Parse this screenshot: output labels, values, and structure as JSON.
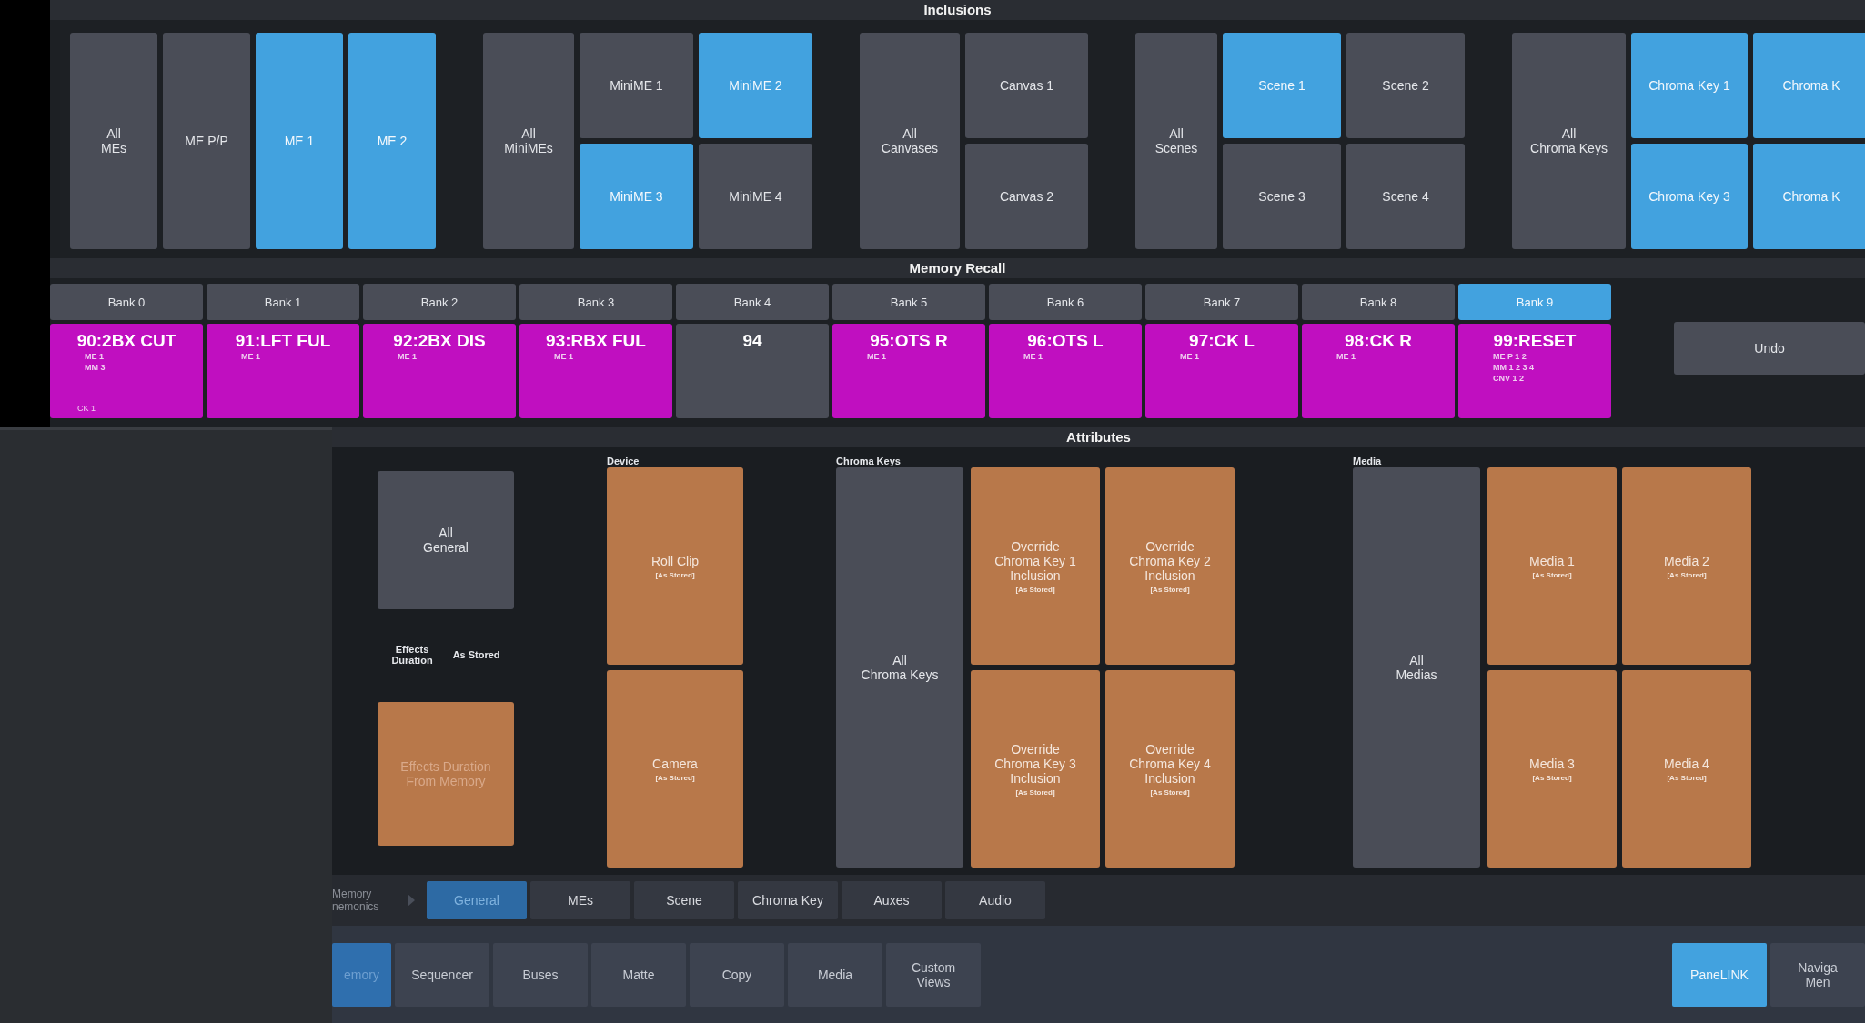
{
  "inclusions": {
    "title": "Inclusions",
    "groups": [
      {
        "kind": "columns",
        "items": [
          {
            "label": "All\nMEs",
            "selected": false
          },
          {
            "label": "ME P/P",
            "selected": false
          },
          {
            "label": "ME 1",
            "selected": true
          },
          {
            "label": "ME 2",
            "selected": true
          }
        ]
      },
      {
        "kind": "grid",
        "all": {
          "label": "All\nMiniMEs",
          "selected": false
        },
        "items": [
          {
            "label": "MiniME 1",
            "selected": false
          },
          {
            "label": "MiniME 2",
            "selected": true
          },
          {
            "label": "MiniME 3",
            "selected": true
          },
          {
            "label": "MiniME 4",
            "selected": false
          }
        ]
      },
      {
        "kind": "grid",
        "all": {
          "label": "All\nCanvases",
          "selected": false
        },
        "items": [
          {
            "label": "Canvas 1",
            "selected": false
          },
          {
            "label": "Canvas 2",
            "selected": false
          }
        ]
      },
      {
        "kind": "grid",
        "all": {
          "label": "All\nScenes",
          "selected": false
        },
        "items": [
          {
            "label": "Scene 1",
            "selected": true
          },
          {
            "label": "Scene 2",
            "selected": false
          },
          {
            "label": "Scene 3",
            "selected": false
          },
          {
            "label": "Scene 4",
            "selected": false
          }
        ]
      },
      {
        "kind": "grid",
        "all": {
          "label": "All\nChroma Keys",
          "selected": false
        },
        "items": [
          {
            "label": "Chroma Key 1",
            "selected": true
          },
          {
            "label": "Chroma K",
            "selected": true
          },
          {
            "label": "Chroma Key 3",
            "selected": true
          },
          {
            "label": "Chroma K",
            "selected": true
          }
        ]
      }
    ]
  },
  "memory_recall": {
    "title": "Memory Recall",
    "banks": [
      {
        "label": "Bank 0",
        "selected": false,
        "memory": {
          "stored": true,
          "title": "90:2BX CUT",
          "details": [
            "ME 1",
            "MM 3"
          ],
          "footer": "CK 1"
        }
      },
      {
        "label": "Bank 1",
        "selected": false,
        "memory": {
          "stored": true,
          "title": "91:LFT FUL",
          "details": [
            "ME 1"
          ]
        }
      },
      {
        "label": "Bank 2",
        "selected": false,
        "memory": {
          "stored": true,
          "title": "92:2BX DIS",
          "details": [
            "ME 1"
          ]
        }
      },
      {
        "label": "Bank 3",
        "selected": false,
        "memory": {
          "stored": true,
          "title": "93:RBX FUL",
          "details": [
            "ME 1"
          ]
        }
      },
      {
        "label": "Bank 4",
        "selected": false,
        "memory": {
          "stored": false,
          "title": "94"
        }
      },
      {
        "label": "Bank 5",
        "selected": false,
        "memory": {
          "stored": true,
          "title": "95:OTS R",
          "details": [
            "ME 1"
          ]
        }
      },
      {
        "label": "Bank 6",
        "selected": false,
        "memory": {
          "stored": true,
          "title": "96:OTS L",
          "details": [
            "ME 1"
          ]
        }
      },
      {
        "label": "Bank 7",
        "selected": false,
        "memory": {
          "stored": true,
          "title": "97:CK L",
          "details": [
            "ME 1"
          ]
        }
      },
      {
        "label": "Bank 8",
        "selected": false,
        "memory": {
          "stored": true,
          "title": "98:CK R",
          "details": [
            "ME 1"
          ]
        }
      },
      {
        "label": "Bank 9",
        "selected": true,
        "memory": {
          "stored": true,
          "title": "99:RESET",
          "details": [
            "ME P 1 2",
            "MM 1 2 3 4",
            "CNV 1 2"
          ]
        }
      }
    ],
    "undo": "Undo"
  },
  "attributes": {
    "title": "Attributes",
    "general": {
      "all": "All\nGeneral",
      "setting_label": "Effects\nDuration",
      "setting_value": "As Stored",
      "effects_button": {
        "label": "Effects Duration\nFrom Memory",
        "disabled": true
      }
    },
    "device": {
      "title": "Device",
      "items": [
        {
          "label": "Roll Clip",
          "value": "[As Stored]"
        },
        {
          "label": "Camera",
          "value": "[As Stored]"
        }
      ]
    },
    "chroma_keys": {
      "title": "Chroma Keys",
      "all": "All\nChroma Keys",
      "items": [
        {
          "label": "Override\nChroma Key 1\nInclusion",
          "value": "[As Stored]"
        },
        {
          "label": "Override\nChroma Key 2\nInclusion",
          "value": "[As Stored]"
        },
        {
          "label": "Override\nChroma Key 3\nInclusion",
          "value": "[As Stored]"
        },
        {
          "label": "Override\nChroma Key 4\nInclusion",
          "value": "[As Stored]"
        }
      ]
    },
    "media": {
      "title": "Media",
      "all": "All\nMedias",
      "items": [
        {
          "label": "Media 1",
          "value": "[As Stored]"
        },
        {
          "label": "Media 2",
          "value": "[As Stored]"
        },
        {
          "label": "Media 3",
          "value": "[As Stored]"
        },
        {
          "label": "Media 4",
          "value": "[As Stored]"
        }
      ]
    }
  },
  "mnemonics_label": "Memory\nnemonics",
  "tabs": [
    {
      "label": "General",
      "selected": true
    },
    {
      "label": "MEs",
      "selected": false
    },
    {
      "label": "Scene",
      "selected": false
    },
    {
      "label": "Chroma Key",
      "selected": false
    },
    {
      "label": "Auxes",
      "selected": false
    },
    {
      "label": "Audio",
      "selected": false
    }
  ],
  "nav": [
    {
      "label": "emory",
      "selected": true
    },
    {
      "label": "Sequencer",
      "selected": false
    },
    {
      "label": "Buses",
      "selected": false
    },
    {
      "label": "Matte",
      "selected": false
    },
    {
      "label": "Copy",
      "selected": false
    },
    {
      "label": "Media",
      "selected": false
    },
    {
      "label": "Custom\nViews",
      "selected": false
    }
  ],
  "nav_right": [
    {
      "label": "PaneLINK",
      "selected": true
    },
    {
      "label": "Naviga\nMen",
      "selected": false
    }
  ]
}
